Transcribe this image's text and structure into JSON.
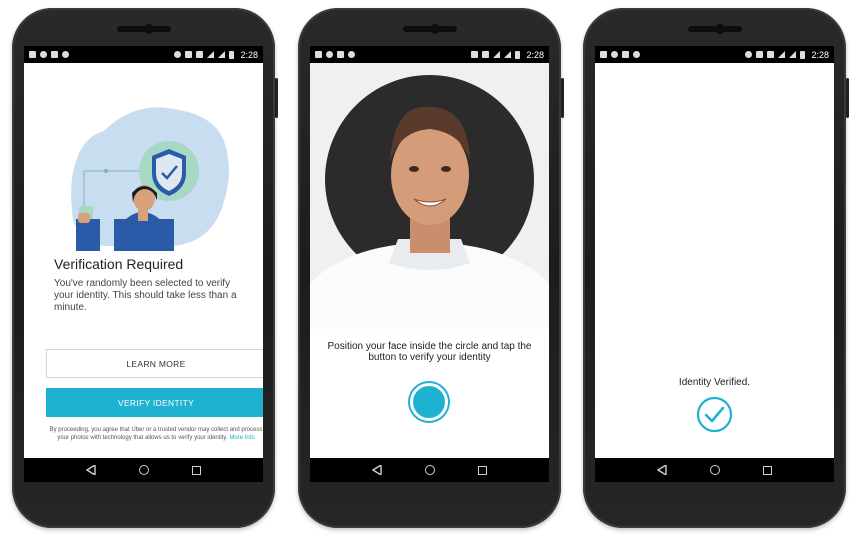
{
  "status_bar": {
    "time": "2:28"
  },
  "screen1": {
    "title": "Verification Required",
    "body": "You've randomly been selected to verify your identity. This should take less than a minute.",
    "learn_more": "LEARN MORE",
    "verify": "VERIFY IDENTITY",
    "fine_print": "By proceeding, you agree that Uber or a trusted vendor may collect and process your photos with technology that allows us to verify your identity.",
    "more_info": "More Info"
  },
  "screen2": {
    "instruction": "Position your face inside the circle and tap the button to verify your identity"
  },
  "screen3": {
    "verified_text": "Identity Verified."
  },
  "colors": {
    "accent": "#1fb1d0",
    "illustration_blue": "#c9ddf0",
    "shield_green": "#a7d7c5",
    "person_shirt": "#2a5ba8"
  }
}
